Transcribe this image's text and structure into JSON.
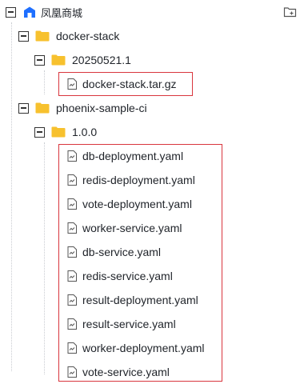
{
  "root": {
    "label": "凤凰商城",
    "icon": "store-icon",
    "action_icon": "add-folder-icon"
  },
  "tree": {
    "docker_stack": {
      "label": "docker-stack",
      "version": {
        "label": "20250521.1",
        "files": [
          "docker-stack.tar.gz"
        ]
      }
    },
    "phoenix": {
      "label": "phoenix-sample-ci",
      "version": {
        "label": "1.0.0",
        "files": [
          "db-deployment.yaml",
          "redis-deployment.yaml",
          "vote-deployment.yaml",
          "worker-service.yaml",
          "db-service.yaml",
          "redis-service.yaml",
          "result-deployment.yaml",
          "result-service.yaml",
          "worker-deployment.yaml",
          "vote-service.yaml"
        ]
      }
    }
  },
  "colors": {
    "folder": "#f7c12e",
    "highlight_border": "#d9363e",
    "root_icon": "#1e6fff",
    "text": "#1f2329"
  }
}
